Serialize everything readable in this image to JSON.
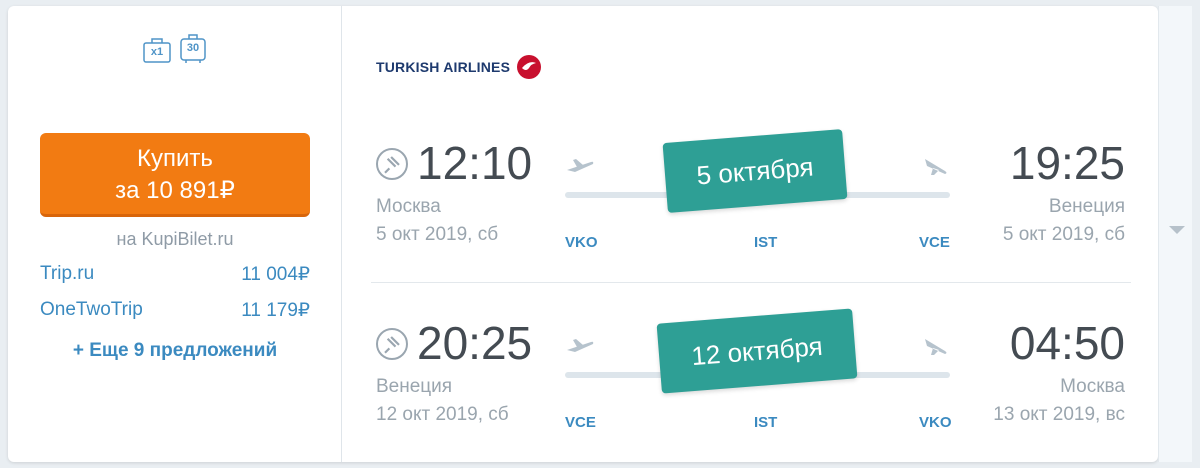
{
  "left_panel": {
    "baggage": {
      "bag_count": "x1",
      "luggage_weight": "30",
      "icons": [
        "bag-icon",
        "suitcase-icon"
      ]
    },
    "buy_button": {
      "line1": "Купить",
      "line2": "за 10 891₽"
    },
    "vendor_label": "на KupiBilet.ru",
    "offers": [
      {
        "name": "Trip.ru",
        "price": "11 004₽"
      },
      {
        "name": "OneTwoTrip",
        "price": "11 179₽"
      }
    ],
    "more_offers": "+ Еще 9 предложений"
  },
  "airline": {
    "name": "TURKISH AIRLINES",
    "logo_color": "#c8102e"
  },
  "legs": [
    {
      "depart_time": "12:10",
      "depart_city": "Москва",
      "depart_date": "5 окт 2019, сб",
      "arrive_time": "19:25",
      "arrive_city": "Венеция",
      "arrive_date": "5 окт 2019, сб",
      "badge": "5 октября",
      "codes": [
        "VKO",
        "IST",
        "VCE"
      ]
    },
    {
      "depart_time": "20:25",
      "depart_city": "Венеция",
      "depart_date": "12 окт 2019, сб",
      "arrive_time": "04:50",
      "arrive_city": "Москва",
      "arrive_date": "13 окт 2019, вс",
      "badge": "12 октября",
      "codes": [
        "VCE",
        "IST",
        "VKO"
      ]
    }
  ],
  "colors": {
    "accent": "#f27b12",
    "badge": "#2e9f95",
    "link": "#3b8ac0"
  }
}
